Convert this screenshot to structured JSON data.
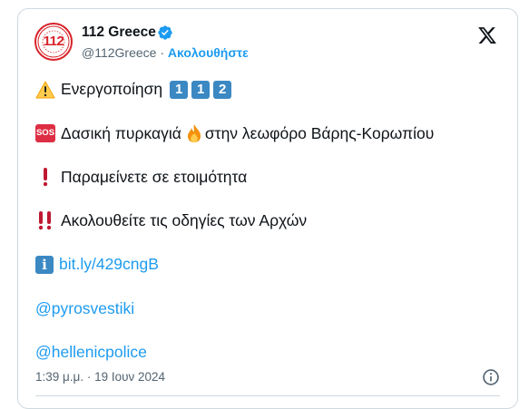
{
  "header": {
    "name": "112 Greece",
    "handle": "@112Greece",
    "separator": "·",
    "follow_label": "Ακολουθήστε",
    "avatar_text": "112"
  },
  "tweet": {
    "lines": [
      {
        "id": "activation",
        "text": "Ενεργοποίηση",
        "keycaps": [
          "1",
          "1",
          "2"
        ]
      },
      {
        "id": "fire",
        "text_before": "Δασική πυρκαγιά",
        "text_after": "στην λεωφόρο Βάρης-Κορωπίου",
        "badge": "SOS"
      },
      {
        "id": "standby",
        "text": "Παραμείνετε σε ετοιμότητα"
      },
      {
        "id": "instructions",
        "text": "Ακολουθείτε τις οδηγίες των Αρχών"
      },
      {
        "id": "link",
        "text": "bit.ly/429cngB",
        "badge": "i"
      },
      {
        "id": "mention1",
        "text": "@pyrosvestiki"
      },
      {
        "id": "mention2",
        "text": "@hellenicpolice"
      }
    ],
    "timestamp": "1:39 μ.μ. · 19 Ιουν 2024"
  },
  "colors": {
    "accent": "#1d9bf0",
    "text": "#0f1419",
    "muted": "#536471",
    "brand_red": "#d8232a",
    "keycap_blue": "#3b88c3"
  },
  "icons": [
    "verified-badge-icon",
    "x-logo-icon",
    "warning-icon",
    "sos-icon",
    "fire-icon",
    "exclamation-icon",
    "double-exclamation-icon",
    "information-icon",
    "info-circle-icon"
  ]
}
